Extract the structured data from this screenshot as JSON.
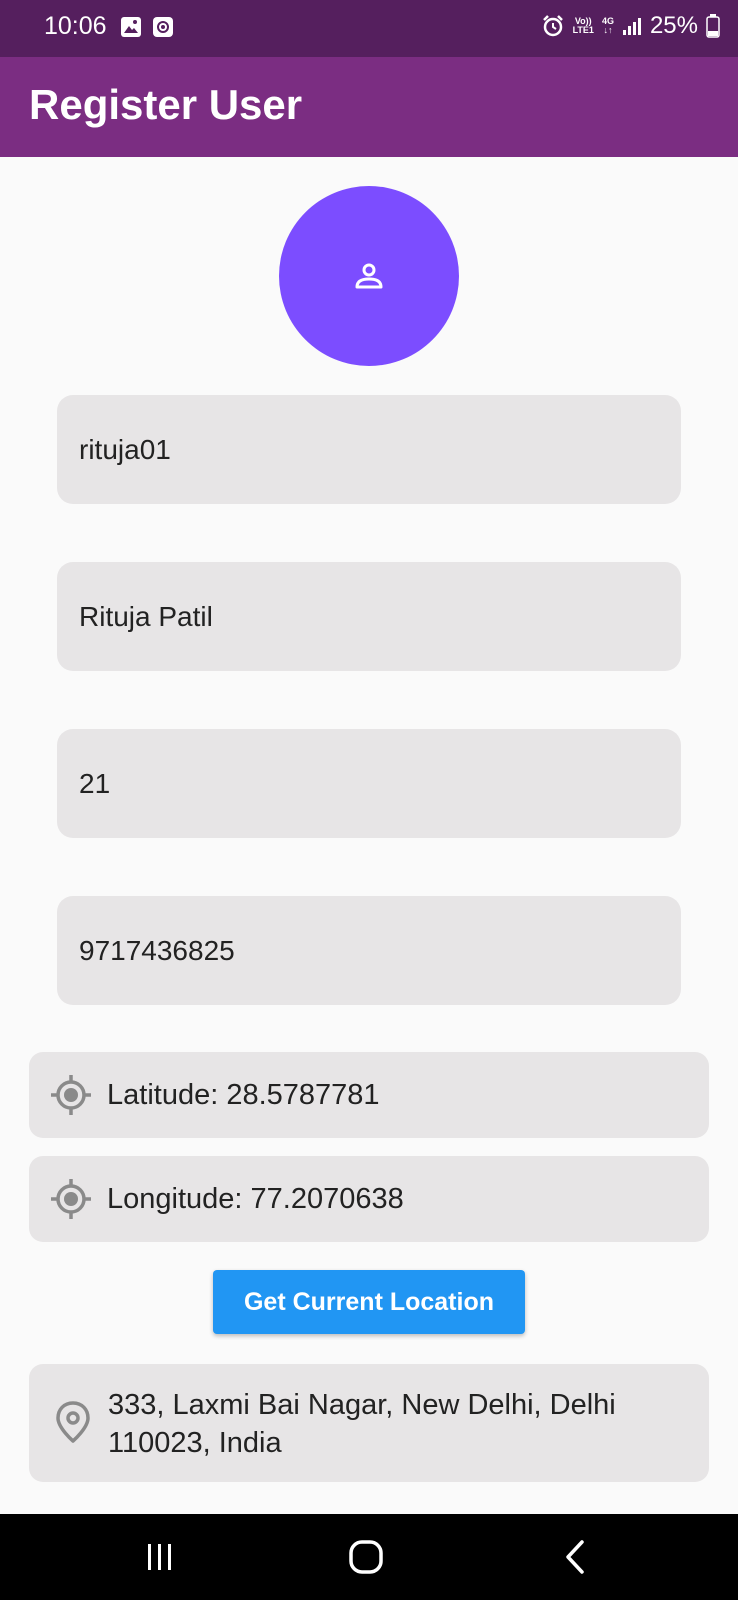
{
  "status_bar": {
    "time": "10:06",
    "icons": [
      "image-icon",
      "screen-record-icon",
      "alarm-icon",
      "volte-icon",
      "4g-data-icon",
      "signal-icon",
      "battery-icon"
    ],
    "volte_top": "Vo))",
    "volte_bottom": "LTE1",
    "network": "4G",
    "battery": "25%"
  },
  "app_bar": {
    "title": "Register User",
    "color": "#7b2d82"
  },
  "avatar": {
    "icon": "person-icon",
    "color": "#7c4dff"
  },
  "form": {
    "username": "rituja01",
    "full_name": "Rituja Patil",
    "age": "21",
    "phone": "9717436825"
  },
  "location": {
    "latitude": "Latitude: 28.5787781",
    "longitude": "Longitude: 77.2070638",
    "icon": "gps-fixed-icon",
    "button_label": "Get Current Location",
    "button_color": "#2196f3",
    "address": "333, Laxmi Bai Nagar, New Delhi, Delhi 110023, India",
    "address_icon": "location-pin-icon"
  },
  "nav_bar": {
    "icons": [
      "recent-apps-icon",
      "home-icon",
      "back-icon"
    ]
  }
}
